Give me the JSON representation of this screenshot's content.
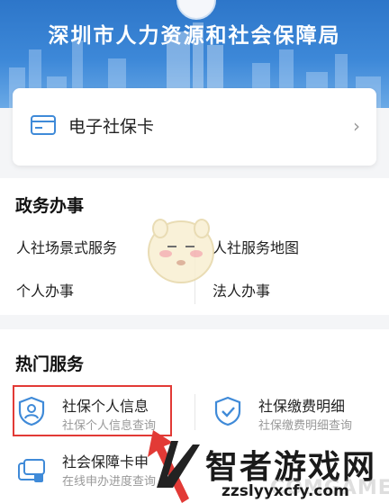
{
  "header": {
    "title": "深圳市人力资源和社会保障局"
  },
  "card": {
    "label": "电子社保卡",
    "chevron": "›",
    "icon": "card-icon"
  },
  "gov_affairs": {
    "title": "政务办事",
    "items": [
      "人社场景式服务",
      "人社服务地图",
      "个人办事",
      "法人办事"
    ]
  },
  "hot_services": {
    "title": "热门服务",
    "items": [
      {
        "title": "社保个人信息",
        "subtitle": "社保个人信息查询",
        "icon": "person-shield-icon"
      },
      {
        "title": "社保缴费明细",
        "subtitle": "社保缴费明细查询",
        "icon": "check-shield-icon"
      },
      {
        "title": "社会保障卡申",
        "subtitle": "在线申办进度查询",
        "icon": "card-stack-icon"
      }
    ]
  },
  "watermark": {
    "name": "智者游戏网",
    "url": "zzslyyxcfy.com",
    "faint": "COMGAME"
  },
  "colors": {
    "header_blue": "#3d88d8",
    "accent_blue": "#3f8ad8",
    "highlight_red": "#e23a36"
  }
}
